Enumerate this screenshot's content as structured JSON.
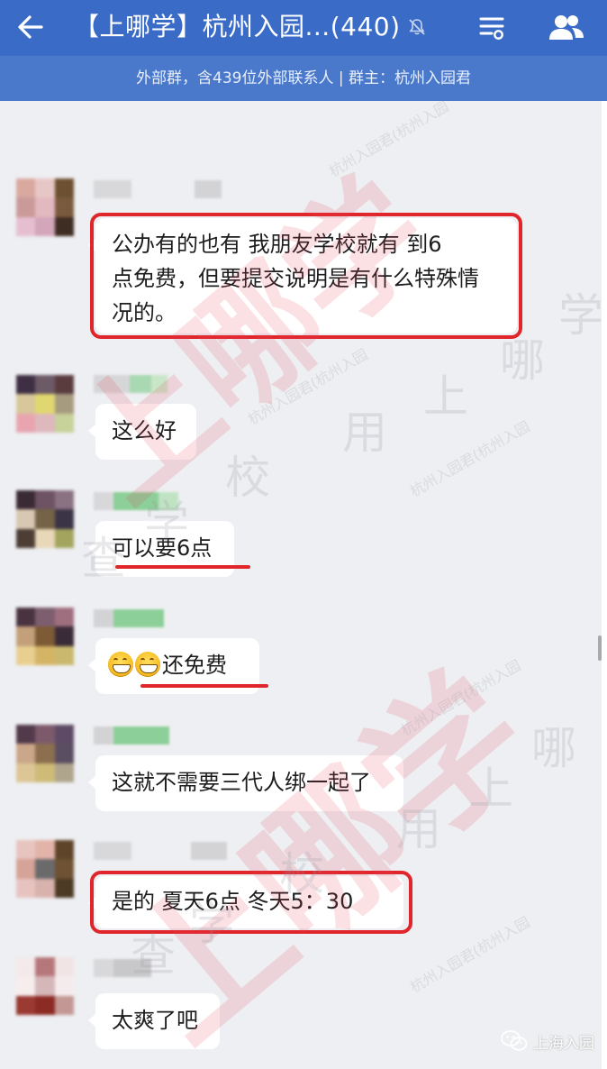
{
  "header": {
    "title": "【上哪学】杭州入园...(440)",
    "subtitle": "外部群，含439位外部联系人 | 群主：杭州入园君"
  },
  "messages": [
    {
      "lines": [
        "公办有的也有  我朋友学校就有    到6",
        "点免费，但要提交说明是有什么特殊情",
        "况的。"
      ],
      "highlight": "box"
    },
    {
      "text": "这么好",
      "highlight": "none"
    },
    {
      "text": "可以要6点",
      "highlight": "underline"
    },
    {
      "text": "还免费",
      "emojis": [
        "grinning-face-emoji",
        "grinning-face-emoji"
      ],
      "highlight": "underline"
    },
    {
      "text": "这就不需要三代人绑一起了",
      "highlight": "none"
    },
    {
      "text": "是的 夏天6点    冬天5：30",
      "highlight": "box"
    },
    {
      "text": "太爽了吧",
      "highlight": "none"
    }
  ],
  "watermarks": {
    "brand": "上哪学",
    "group": "杭州入园君(杭州入园",
    "chars": [
      "用",
      "上",
      "哪",
      "学",
      "校",
      "查"
    ]
  },
  "corner_logo": "上海入园",
  "colors": {
    "topbar": "#3a6bc6",
    "subbar": "#4a79cc",
    "highlight": "#e0262b",
    "background": "#eeeff2",
    "bubble": "#ffffff"
  },
  "icons": [
    "back-arrow-icon",
    "mute-bell-icon",
    "group-menu-icon",
    "members-icon",
    "wechat-icon"
  ]
}
